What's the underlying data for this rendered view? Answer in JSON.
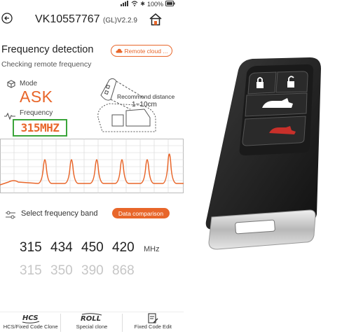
{
  "status_bar": {
    "battery": "100%"
  },
  "header": {
    "title": "VK10557767",
    "version": "(GL)V2.2.9"
  },
  "detection": {
    "title": "Frequency detection",
    "remote_cloud_label": "Remote cloud ...",
    "subtitle": "Checking remote frequency",
    "mode_label": "Mode",
    "mode_value": "ASK",
    "frequency_label": "Frequency",
    "frequency_value": "315MHZ",
    "recommend_label": "Recommend distance",
    "recommend_range": "1~10cm"
  },
  "band": {
    "label": "Select frequency band",
    "compare_label": "Data comparison",
    "unit": "MHz",
    "row1": [
      "315",
      "434",
      "450",
      "420"
    ],
    "row2": [
      "315",
      "350",
      "390",
      "868"
    ]
  },
  "tabs": [
    {
      "label": "HCS/Fixed Code Clone",
      "icon": "hcs-icon"
    },
    {
      "label": "Special clone",
      "icon": "roll-icon"
    },
    {
      "label": "Fixed Code Edit",
      "icon": "edit-doc-icon"
    }
  ],
  "colors": {
    "accent": "#e8662a",
    "highlight_box": "#3aa53a"
  }
}
